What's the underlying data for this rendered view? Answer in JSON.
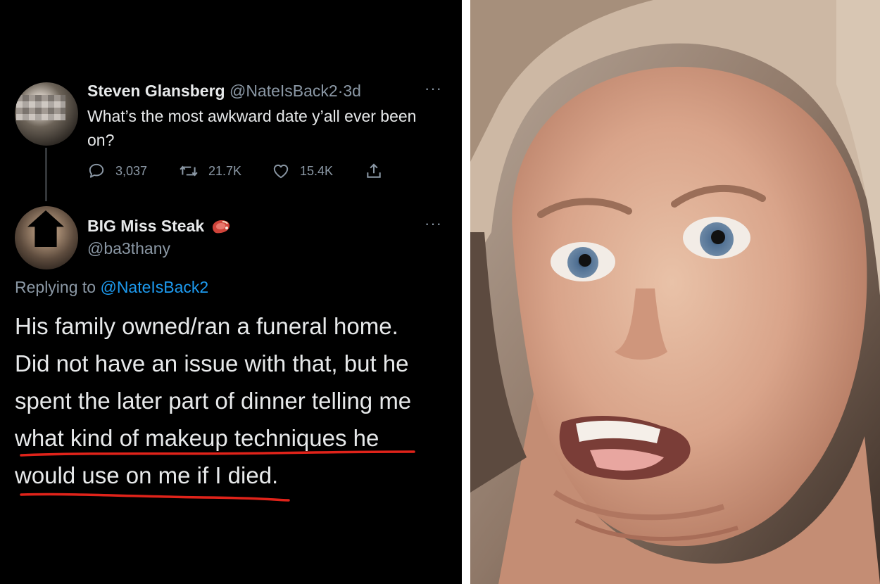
{
  "tweet": {
    "author_name": "Steven Glansberg",
    "author_handle": "@NateIsBack2",
    "time": "3d",
    "separator": "·",
    "more": "···",
    "text": "What’s the most awkward date y’all ever been on?",
    "reply_count": "3,037",
    "retweet_count": "21.7K",
    "like_count": "15.4K"
  },
  "reply": {
    "author_name": "BIG Miss Steak",
    "author_handle": "@ba3thany",
    "more": "···",
    "replying_prefix": "Replying to",
    "replying_handle": "@NateIsBack2",
    "lines": [
      "His family owned/ran a funeral home.",
      "Did not have an issue with that, but he",
      "spent the later part of dinner telling me",
      "what kind of makeup  techniques he",
      "would use on me if I died."
    ]
  },
  "colors": {
    "background": "#000000",
    "text": "#e7e9ea",
    "secondary": "#8b98a5",
    "mention": "#1d9bf0",
    "underline": "#e0231a"
  },
  "icons": {
    "reply": "speech-bubble",
    "retweet": "retweet-arrows",
    "like": "heart",
    "share": "upload-arrow",
    "name_emoji": "steak"
  }
}
